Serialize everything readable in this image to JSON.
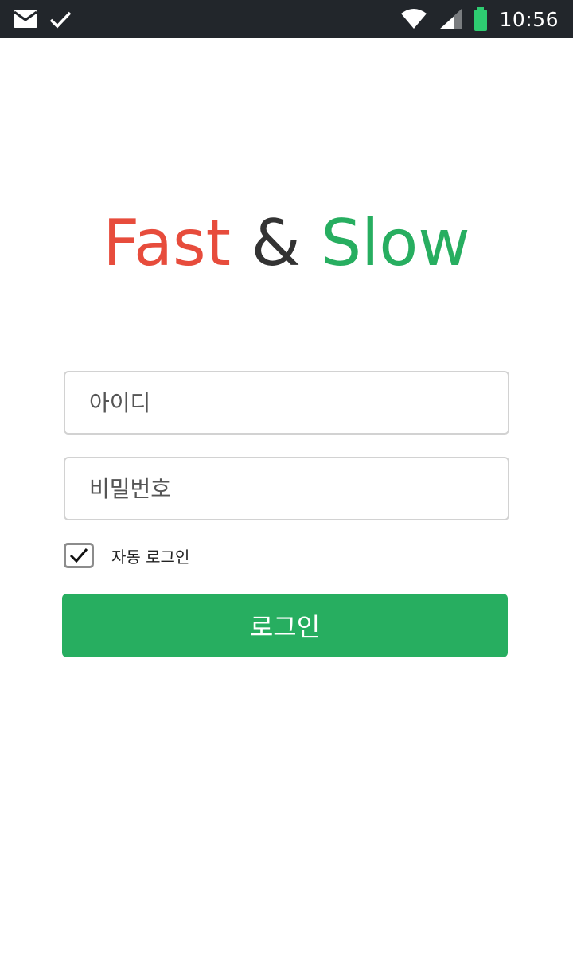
{
  "status_bar": {
    "time": "10:56",
    "left_icons": [
      "mail-icon",
      "check-icon"
    ],
    "right_icons": [
      "wifi-icon",
      "cell-signal-icon",
      "battery-icon"
    ],
    "battery_color": "#2ecc71"
  },
  "title": {
    "part1": "Fast",
    "part2": "&",
    "part3": "Slow",
    "colors": {
      "part1": "#e74c3c",
      "part2": "#333333",
      "part3": "#27ae60"
    }
  },
  "form": {
    "id_placeholder": "아이디",
    "id_value": "",
    "password_placeholder": "비밀번호",
    "password_value": "",
    "auto_login": {
      "label": "자동 로그인",
      "checked": true
    },
    "login_button": "로그인",
    "accent_color": "#27ae60"
  }
}
